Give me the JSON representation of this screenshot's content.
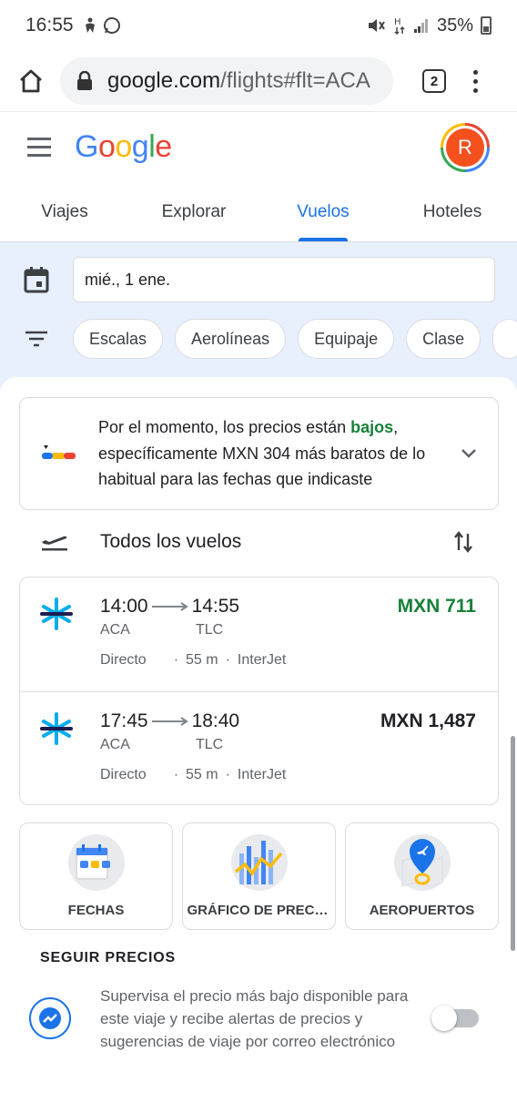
{
  "status_bar": {
    "time": "16:55",
    "battery": "35%"
  },
  "browser": {
    "url_host": "google.com",
    "url_path": "/flights#flt=ACA",
    "tab_count": "2"
  },
  "header": {
    "logo_text": "Google",
    "avatar_letter": "R"
  },
  "nav": {
    "tabs": [
      {
        "label": "Viajes"
      },
      {
        "label": "Explorar"
      },
      {
        "label": "Vuelos"
      },
      {
        "label": "Hoteles"
      }
    ],
    "active": "Vuelos"
  },
  "search": {
    "date": "mié., 1 ene.",
    "filters": [
      {
        "label": "Escalas"
      },
      {
        "label": "Aerolíneas"
      },
      {
        "label": "Equipaje"
      },
      {
        "label": "Clase"
      }
    ]
  },
  "price_insight": {
    "text_before": "Por el momento, los precios están ",
    "highlight": "bajos",
    "text_after": ", específicamente MXN 304 más baratos de lo habitual para las fechas que indicaste"
  },
  "flights_section": {
    "title": "Todos los vuelos"
  },
  "flights": [
    {
      "depart": "14:00",
      "arrive": "14:55",
      "from": "ACA",
      "to": "TLC",
      "stops": "Directo",
      "duration": "55 m",
      "airline": "InterJet",
      "price": "MXN 711"
    },
    {
      "depart": "17:45",
      "arrive": "18:40",
      "from": "ACA",
      "to": "TLC",
      "stops": "Directo",
      "duration": "55 m",
      "airline": "InterJet",
      "price": "MXN 1,487"
    }
  ],
  "explore_cards": [
    {
      "label": "FECHAS",
      "icon": "calendar-illustration-icon"
    },
    {
      "label": "GRÁFICO DE PRECIOS",
      "icon": "price-graph-illustration-icon"
    },
    {
      "label": "AEROPUERTOS",
      "icon": "airport-map-illustration-icon"
    }
  ],
  "track_prices": {
    "header": "SEGUIR PRECIOS",
    "description": "Supervisa el precio más bajo disponible para este viaje y recibe alertas de precios y sugerencias de viaje por correo electrónico",
    "enabled": false
  },
  "colors": {
    "accent": "#1a73e8",
    "cheap_price": "#188038",
    "search_bg": "#e8f0fe"
  }
}
